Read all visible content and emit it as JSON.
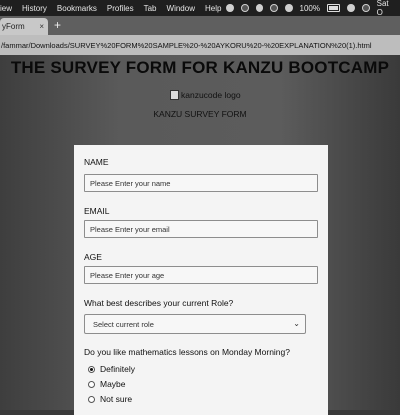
{
  "menubar": {
    "items": [
      "iew",
      "History",
      "Bookmarks",
      "Profiles",
      "Tab",
      "Window",
      "Help"
    ],
    "battery": "100%",
    "clock": "Sat O"
  },
  "browser": {
    "tab_title": "yForm",
    "tab_close": "×",
    "new_tab": "+",
    "address": "/fammar/Downloads/SURVEY%20FORM%20SAMPLE%20-%20AYKORU%20-%20EXPLANATION%20(1).html"
  },
  "page": {
    "title": "THE SURVEY FORM FOR KANZU BOOTCAMP",
    "logo_alt": "kanzucode logo",
    "subtitle": "KANZU SURVEY FORM"
  },
  "form": {
    "name_label": "NAME",
    "name_placeholder": "Please Enter your name",
    "email_label": "EMAIL",
    "email_placeholder": "Please Enter your email",
    "age_label": "AGE",
    "age_placeholder": "Please Enter your age",
    "role_label": "What best describes your current Role?",
    "role_select": "Select current role",
    "math_label": "Do you like mathematics lessons on Monday Morning?",
    "options": [
      "Definitely",
      "Maybe",
      "Not sure"
    ],
    "selected_option": "Definitely"
  }
}
